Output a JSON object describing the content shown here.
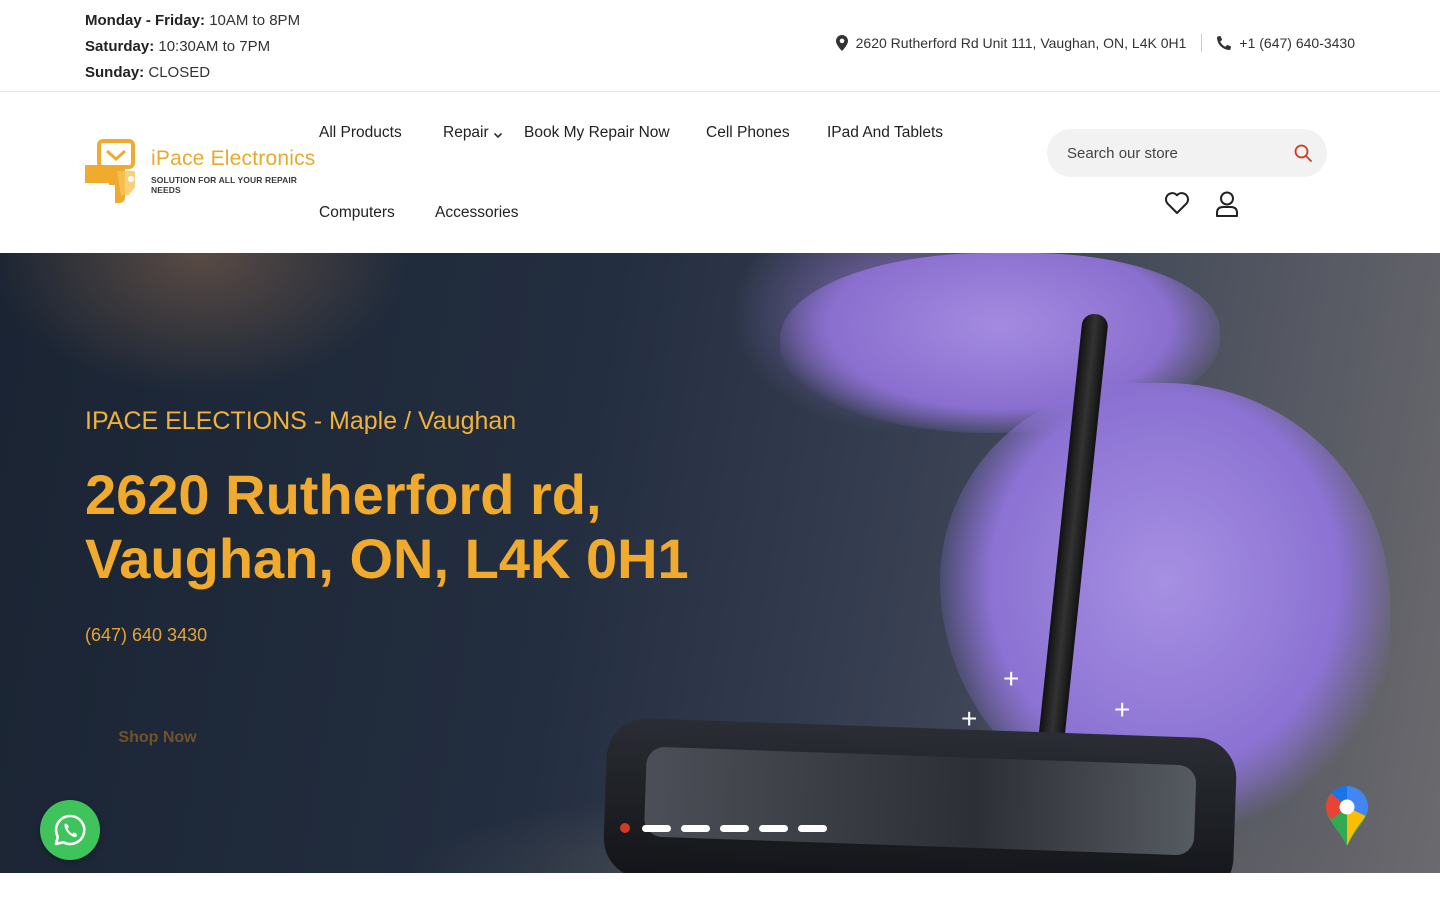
{
  "hours": [
    {
      "day": "Monday - Friday:",
      "time": "10AM to 8PM"
    },
    {
      "day": "Saturday:",
      "time": "10:30AM to 7PM"
    },
    {
      "day": "Sunday:",
      "time": "CLOSED"
    }
  ],
  "contact": {
    "address": "2620 Rutherford Rd Unit 111, Vaughan, ON, L4K 0H1",
    "phone": "+1 (647) 640-3430"
  },
  "logo": {
    "title": "iPace Electronics",
    "tagline": "SOLUTION FOR ALL YOUR REPAIR NEEDS"
  },
  "nav": {
    "items": [
      "All Products",
      "Repair",
      "Book My Repair Now",
      "Cell Phones",
      "IPad And Tablets",
      "Computers",
      "Accessories"
    ]
  },
  "search": {
    "placeholder": "Search our store"
  },
  "hero": {
    "subtitle": "IPACE ELECTIONS - Maple / Vaughan",
    "title": "2620 Rutherford rd, Vaughan, ON, L4K 0H1",
    "phone": "(647) 640 3430",
    "cta": "Shop Now",
    "slide_count": 6,
    "active_slide": 1
  },
  "colors": {
    "accent": "#f0ab2e",
    "active_dot": "#d23a24",
    "whatsapp": "#3fc45b"
  }
}
